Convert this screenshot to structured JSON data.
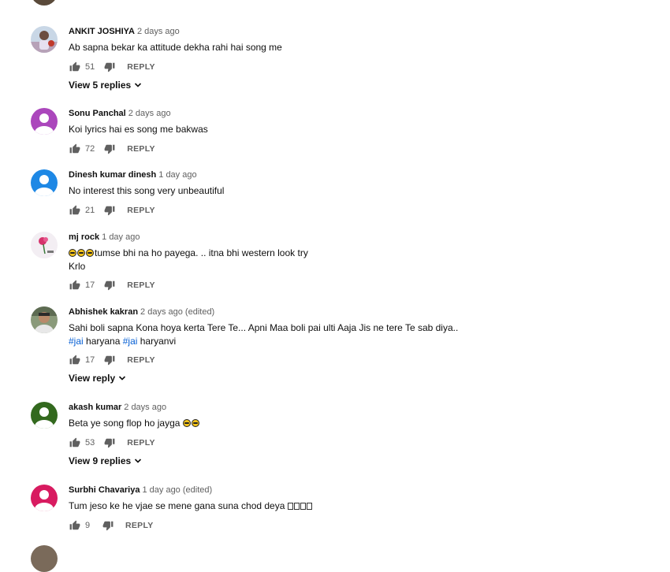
{
  "labels": {
    "reply": "REPLY"
  },
  "comments": [
    {
      "author": "ANKIT JOSHIYA",
      "time": "2 days ago",
      "text": "Ab sapna bekar ka attitude dekha rahi hai song me",
      "likes": "51",
      "view_replies": "View 5 replies",
      "avatar_color": "#c9d7e6"
    },
    {
      "author": "Sonu Panchal",
      "time": "2 days ago",
      "text": "Koi lyrics hai es song me bakwas",
      "likes": "72",
      "avatar_color": "#ab47bc"
    },
    {
      "author": "Dinesh kumar dinesh",
      "time": "1 day ago",
      "text": "No interest this song very unbeautiful",
      "likes": "21",
      "avatar_color": "#1e88e5"
    },
    {
      "author": "mj rock",
      "time": "1 day ago",
      "text_part": "tumse bhi na ho payega. .. itna  bhi  western look try",
      "text_line2": "Krlo",
      "likes": "17",
      "avatar_color": "#f3eef3"
    },
    {
      "author": "Abhishek kakran",
      "time": "2 days ago (edited)",
      "text_line1": "Sahi boli sapna Kona hoya kerta Tere Te... Apni Maa boli pai ulti Aaja Jis ne tere Te sab diya..",
      "hashtag1": "#jai",
      "word1": " haryana ",
      "hashtag2": "#jai",
      "word2": " haryanvi",
      "likes": "17",
      "view_replies": "View reply",
      "avatar_color": "#6d7a5e"
    },
    {
      "author": "akash kumar",
      "time": "2 days ago",
      "text": "Beta ye song flop ho jayga ",
      "likes": "53",
      "view_replies": "View 9 replies",
      "avatar_color": "#33691e"
    },
    {
      "author": "Surbhi Chavariya",
      "time": "1 day ago (edited)",
      "text": "Tum jeso ke  he vjae se mene gana  suna chod deya ",
      "likes": "9",
      "avatar_color": "#d81b60"
    }
  ]
}
